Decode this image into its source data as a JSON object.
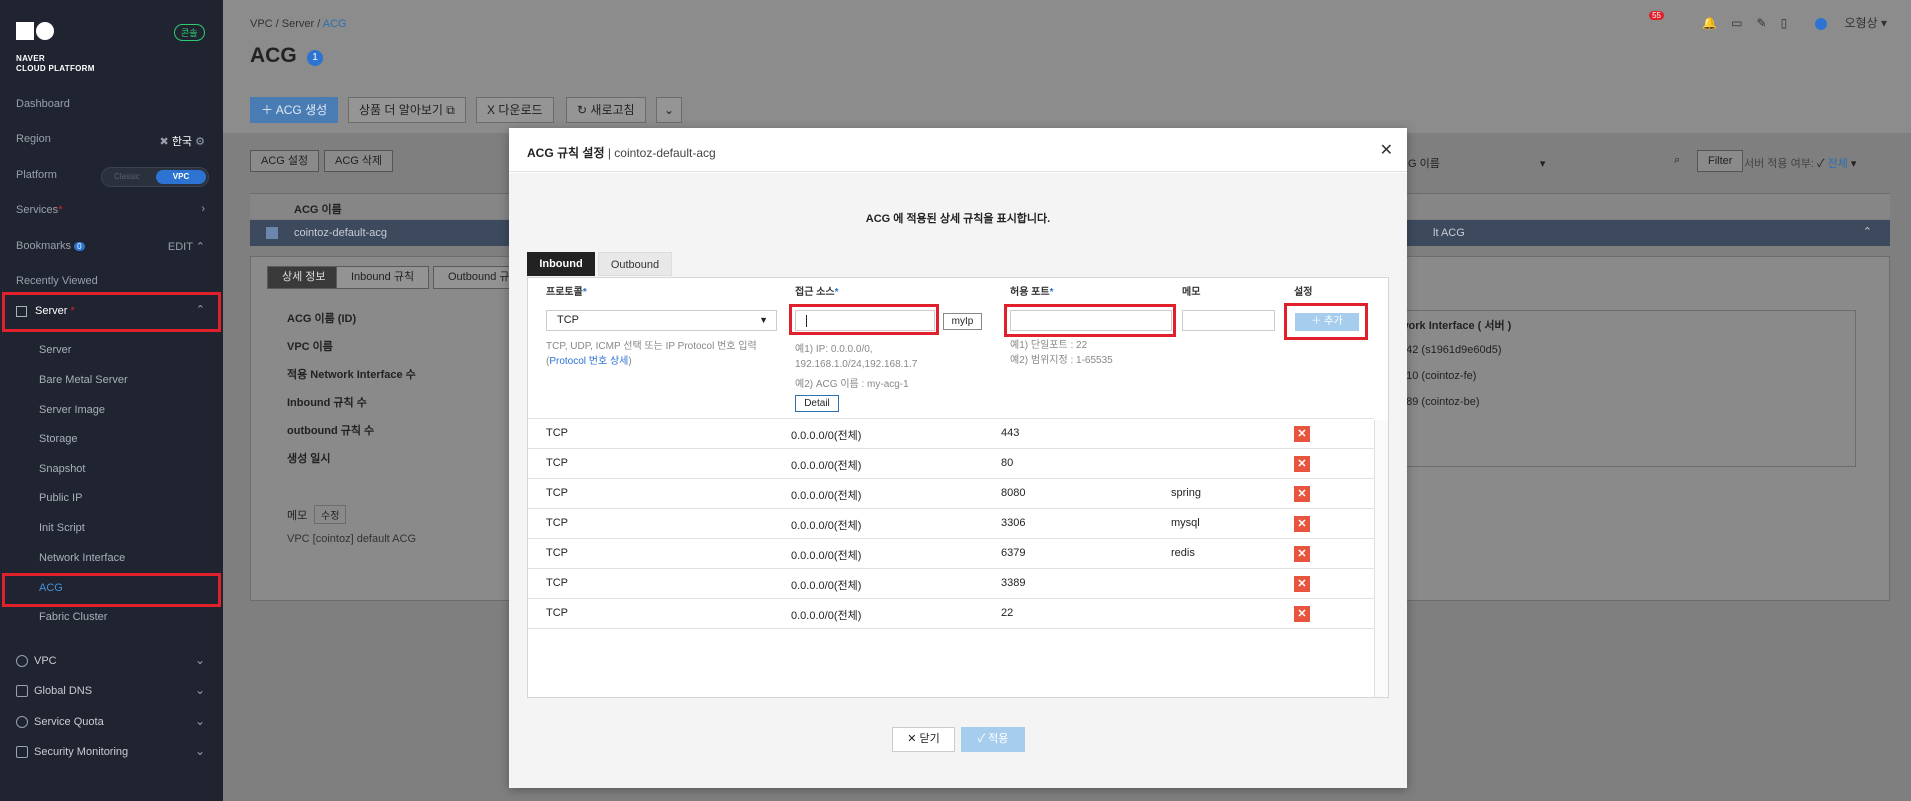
{
  "sidebar": {
    "logo_text_1": "NAVER",
    "logo_text_2": "CLOUD PLATFORM",
    "console_badge": "콘솔",
    "dashboard": "Dashboard",
    "region_label": "Region",
    "region_value": "한국",
    "platform_label": "Platform",
    "platform_off": "Classic",
    "platform_on": "VPC",
    "services": "Services",
    "bookmarks": "Bookmarks",
    "bookmarks_count": "0",
    "bookmarks_edit": "EDIT",
    "recently_viewed": "Recently Viewed",
    "server": "Server",
    "sub_items": [
      "Server",
      "Bare Metal Server",
      "Server Image",
      "Storage",
      "Snapshot",
      "Public IP",
      "Init Script",
      "Network Interface",
      "ACG",
      "Fabric Cluster"
    ],
    "bottom_items": [
      "VPC",
      "Global DNS",
      "Service Quota",
      "Security Monitoring"
    ]
  },
  "header": {
    "breadcrumb": [
      "VPC",
      "Server",
      "ACG"
    ],
    "title": "ACG",
    "title_badge": "1",
    "notif_count": "55",
    "user": "오형상"
  },
  "toolbar": {
    "create": "ACG 생성",
    "learn_more": "상품 더 알아보기",
    "download": "다운로드",
    "refresh": "새로고침"
  },
  "actions": {
    "settings": "ACG 설정",
    "delete": "ACG 삭제",
    "filter_select": "G 이름",
    "filter": "Filter",
    "server_apply_label": "서버 적용 여부:",
    "server_apply_value": "전체"
  },
  "table": {
    "header": "ACG 이름",
    "row_name": "cointoz-default-acg",
    "row_right": "lt ACG"
  },
  "detail": {
    "tabs": [
      "상세 정보",
      "Inbound 규칙",
      "Outbound 규"
    ],
    "labels": [
      "ACG 이름 (ID)",
      "VPC 이름",
      "적용 Network Interface 수",
      "Inbound 규칙 수",
      "outbound 규칙 수",
      "생성 일시"
    ],
    "ni_header": "work Interface ( 서버 )",
    "ni_rows": [
      "142 (s1961d9e60d5)",
      "610 (cointoz-fe)",
      "789 (cointoz-be)"
    ],
    "memo_label": "메모",
    "memo_edit": "수정",
    "memo_value": "VPC [cointoz] default ACG"
  },
  "modal": {
    "title": "ACG 규칙 설정",
    "subtitle": "cointoz-default-acg",
    "description": "ACG 에 적용된 상세 규칙을 표시합니다.",
    "tab_inbound": "Inbound",
    "tab_outbound": "Outbound",
    "col_protocol": "프로토콜",
    "col_source": "접근 소스",
    "col_port": "허용 포트",
    "col_memo": "메모",
    "col_setting": "설정",
    "protocol_value": "TCP",
    "protocol_hint_1": "TCP, UDP, ICMP 선택 또는 IP Protocol 번호 입력",
    "protocol_hint_link": "Protocol 번호 상세",
    "source_hint_1": "예1) IP: 0.0.0.0/0,",
    "source_hint_2": "192.168.1.0/24,192.168.1.7",
    "source_hint_3": "예2) ACG 이름 : my-acg-1",
    "myip": "myIp",
    "detail_btn": "Detail",
    "port_hint_1": "예1) 단일포트 : 22",
    "port_hint_2": "예2) 범위지정 : 1-65535",
    "add_btn": "추가",
    "rules": [
      {
        "protocol": "TCP",
        "source": "0.0.0.0/0(전체)",
        "port": "443",
        "memo": ""
      },
      {
        "protocol": "TCP",
        "source": "0.0.0.0/0(전체)",
        "port": "80",
        "memo": ""
      },
      {
        "protocol": "TCP",
        "source": "0.0.0.0/0(전체)",
        "port": "8080",
        "memo": "spring"
      },
      {
        "protocol": "TCP",
        "source": "0.0.0.0/0(전체)",
        "port": "3306",
        "memo": "mysql"
      },
      {
        "protocol": "TCP",
        "source": "0.0.0.0/0(전체)",
        "port": "6379",
        "memo": "redis"
      },
      {
        "protocol": "TCP",
        "source": "0.0.0.0/0(전체)",
        "port": "3389",
        "memo": ""
      },
      {
        "protocol": "TCP",
        "source": "0.0.0.0/0(전체)",
        "port": "22",
        "memo": ""
      }
    ],
    "close_btn": "닫기",
    "apply_btn": "적용"
  },
  "colors": {
    "accent": "#2c73d2",
    "highlight": "#e0202a",
    "delete": "#e8553f"
  }
}
